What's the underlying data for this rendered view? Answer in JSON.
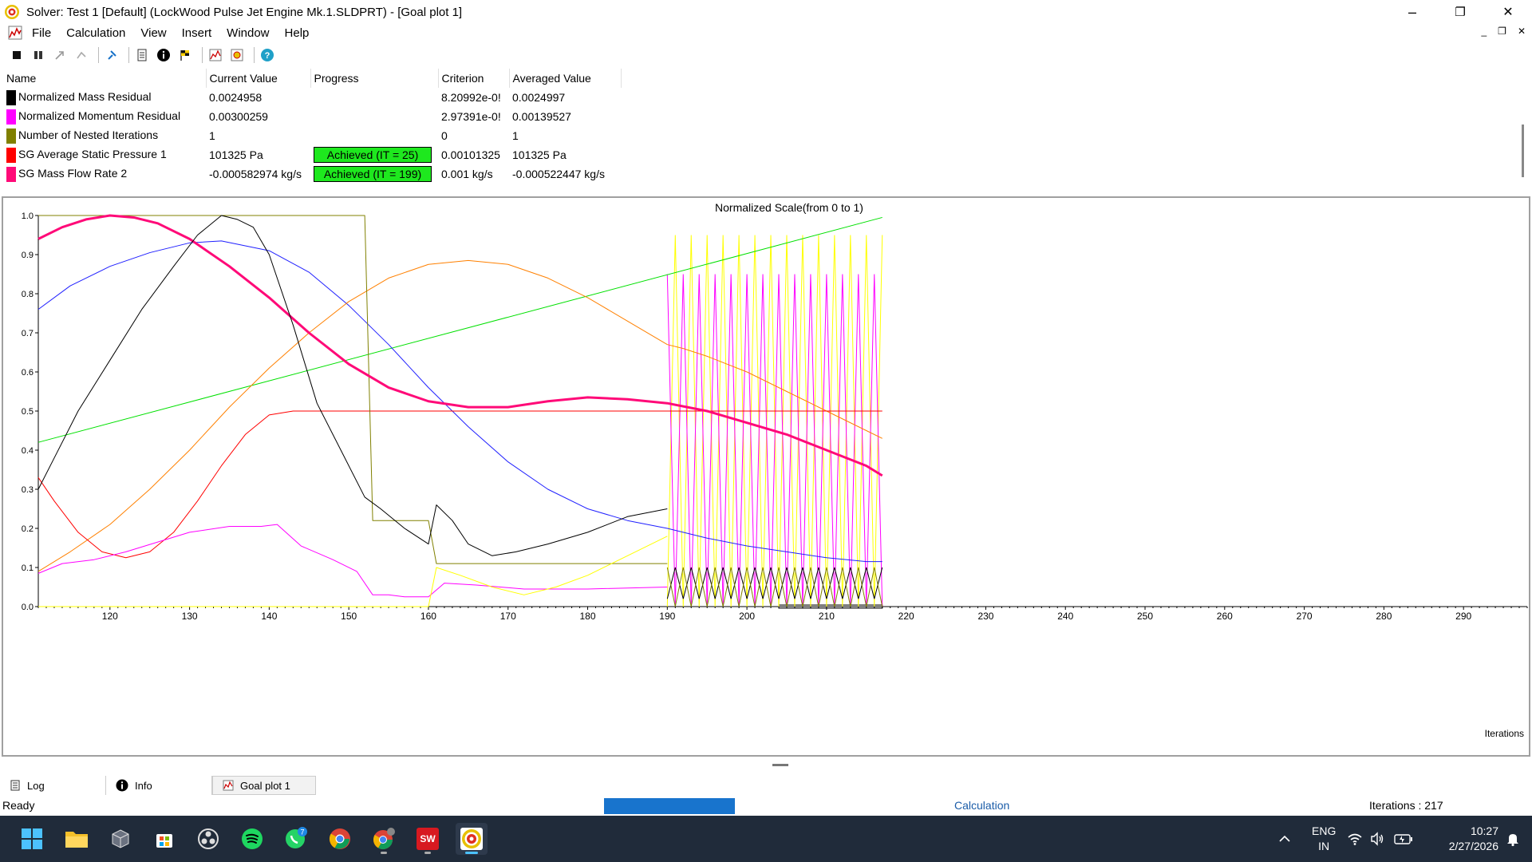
{
  "window": {
    "title": "Solver: Test 1 [Default] (LockWood Pulse Jet Engine Mk.1.SLDPRT) - [Goal plot 1]",
    "minimize": "–",
    "maximize": "❐",
    "close": "✕"
  },
  "menu": {
    "items": [
      "File",
      "Calculation",
      "View",
      "Insert",
      "Window",
      "Help"
    ],
    "mdi_minimize": "_",
    "mdi_restore": "❐",
    "mdi_close": "✕"
  },
  "table": {
    "headers": [
      "Name",
      "Current Value",
      "Progress",
      "Criterion",
      "Averaged Value"
    ],
    "rows": [
      {
        "color": "#000000",
        "name": "Normalized Mass Residual",
        "current": "0.0024958",
        "progress": "",
        "criterion": "8.20992e-0!",
        "averaged": "0.0024997"
      },
      {
        "color": "#ff00ff",
        "name": "Normalized Momentum Residual",
        "current": "0.00300259",
        "progress": "",
        "criterion": "2.97391e-0!",
        "averaged": "0.00139527"
      },
      {
        "color": "#808000",
        "name": "Number of Nested Iterations",
        "current": "1",
        "progress": "",
        "criterion": "0",
        "averaged": "1"
      },
      {
        "color": "#ff0000",
        "name": "SG Average Static Pressure 1",
        "current": "101325 Pa",
        "progress": "Achieved (IT = 25)",
        "criterion": "0.00101325",
        "averaged": "101325 Pa"
      },
      {
        "color": "#ff0a78",
        "name": "SG Mass Flow Rate 2",
        "current": "-0.000582974 kg/s",
        "progress": "Achieved (IT = 199)",
        "criterion": "0.001 kg/s",
        "averaged": "-0.000522447 kg/s"
      }
    ]
  },
  "chart_data": {
    "type": "line",
    "title": "Normalized Scale(from 0 to 1)",
    "xlabel": "Iterations",
    "ylabel": "",
    "xlim": [
      111,
      298
    ],
    "ylim": [
      0,
      1
    ],
    "x_ticks": [
      "120",
      "130",
      "140",
      "150",
      "160",
      "170",
      "180",
      "190",
      "200",
      "210",
      "220",
      "230",
      "240",
      "250",
      "260",
      "270",
      "280",
      "290"
    ],
    "y_ticks": [
      "0.0",
      "0.1",
      "0.2",
      "0.3",
      "0.4",
      "0.5",
      "0.6",
      "0.7",
      "0.8",
      "0.9",
      "1.0"
    ],
    "grid": false,
    "series": [
      {
        "color": "#00e000",
        "width": 1,
        "x": [
          111,
          217
        ],
        "y": [
          0.42,
          0.995
        ]
      },
      {
        "color": "#2020ff",
        "width": 1,
        "x": [
          111,
          115,
          120,
          125,
          130,
          134,
          140,
          145,
          150,
          155,
          160,
          165,
          170,
          175,
          180,
          185,
          190,
          195,
          200,
          205,
          210,
          215,
          217
        ],
        "y": [
          0.76,
          0.82,
          0.87,
          0.905,
          0.93,
          0.935,
          0.91,
          0.855,
          0.77,
          0.67,
          0.56,
          0.46,
          0.37,
          0.3,
          0.25,
          0.22,
          0.2,
          0.175,
          0.155,
          0.14,
          0.125,
          0.115,
          0.115
        ]
      },
      {
        "color": "#ff8000",
        "width": 1,
        "x": [
          111,
          115,
          120,
          125,
          130,
          135,
          140,
          145,
          150,
          155,
          160,
          165,
          170,
          175,
          180,
          185,
          190,
          192,
          195,
          200,
          205,
          210,
          215,
          217
        ],
        "y": [
          0.09,
          0.14,
          0.21,
          0.3,
          0.4,
          0.51,
          0.61,
          0.7,
          0.78,
          0.84,
          0.875,
          0.885,
          0.875,
          0.84,
          0.79,
          0.73,
          0.67,
          0.66,
          0.64,
          0.6,
          0.55,
          0.5,
          0.45,
          0.43
        ]
      },
      {
        "color": "#ff0000",
        "width": 1,
        "x": [
          111,
          113,
          116,
          119,
          122,
          125,
          128,
          131,
          134,
          137,
          140,
          143,
          150,
          160,
          170,
          180,
          190,
          200,
          210,
          217
        ],
        "y": [
          0.33,
          0.27,
          0.19,
          0.14,
          0.125,
          0.14,
          0.19,
          0.27,
          0.36,
          0.44,
          0.49,
          0.5,
          0.5,
          0.5,
          0.5,
          0.5,
          0.5,
          0.5,
          0.5,
          0.5
        ]
      },
      {
        "color": "#808000",
        "width": 1,
        "x": [
          111,
          152,
          153,
          157,
          160,
          161,
          190
        ],
        "y": [
          1.0,
          1.0,
          0.22,
          0.22,
          0.22,
          0.11,
          0.11
        ]
      },
      {
        "color": "#ff0a78",
        "width": 3,
        "x": [
          111,
          114,
          117,
          120,
          123,
          126,
          130,
          135,
          140,
          145,
          150,
          155,
          160,
          165,
          170,
          175,
          180,
          185,
          190,
          195,
          200,
          205,
          210,
          215,
          217
        ],
        "y": [
          0.94,
          0.97,
          0.99,
          1.0,
          0.995,
          0.98,
          0.94,
          0.87,
          0.79,
          0.7,
          0.62,
          0.56,
          0.525,
          0.51,
          0.51,
          0.525,
          0.535,
          0.53,
          0.52,
          0.5,
          0.47,
          0.44,
          0.4,
          0.36,
          0.335
        ]
      },
      {
        "color": "#000000",
        "width": 1,
        "x": [
          111,
          113,
          116,
          120,
          124,
          128,
          131,
          134,
          136,
          138,
          140,
          143,
          146,
          149,
          152,
          154,
          157,
          160,
          161,
          163,
          165,
          168,
          171,
          175,
          180,
          185,
          190
        ],
        "y": [
          0.3,
          0.38,
          0.5,
          0.63,
          0.76,
          0.87,
          0.95,
          1.0,
          0.99,
          0.97,
          0.9,
          0.72,
          0.52,
          0.4,
          0.28,
          0.25,
          0.2,
          0.16,
          0.26,
          0.22,
          0.16,
          0.13,
          0.14,
          0.16,
          0.19,
          0.23,
          0.25
        ]
      },
      {
        "color": "#ff00ff",
        "width": 1,
        "x": [
          111,
          114,
          118,
          122,
          126,
          130,
          135,
          139,
          141,
          144,
          148,
          151,
          153,
          155,
          157,
          160,
          162,
          166,
          172,
          180,
          190
        ],
        "y": [
          0.085,
          0.11,
          0.12,
          0.14,
          0.165,
          0.19,
          0.205,
          0.205,
          0.21,
          0.155,
          0.12,
          0.09,
          0.03,
          0.03,
          0.025,
          0.025,
          0.06,
          0.055,
          0.045,
          0.045,
          0.05
        ]
      },
      {
        "color": "#ffff00",
        "width": 1,
        "x": [
          111,
          160,
          161,
          164,
          168,
          172,
          176,
          180,
          185,
          190
        ],
        "y": [
          0.0,
          0.0,
          0.1,
          0.08,
          0.05,
          0.03,
          0.05,
          0.08,
          0.13,
          0.18
        ]
      }
    ],
    "oscillations": {
      "x_start": 190,
      "x_end": 217,
      "period": 2,
      "series": [
        {
          "color": "#ffff00",
          "low": 0.0,
          "high": 0.95
        },
        {
          "color": "#ff00ff",
          "low": 0.0,
          "high": 0.85
        },
        {
          "color": "#000000",
          "low": 0.02,
          "high": 0.1
        },
        {
          "color": "#808000",
          "low": 0.0,
          "high": 0.1
        }
      ]
    }
  },
  "tabs": [
    {
      "label": "Log",
      "icon": "log-icon"
    },
    {
      "label": "Info",
      "icon": "info-icon"
    },
    {
      "label": "Goal plot 1",
      "icon": "goal-plot-icon"
    }
  ],
  "status": {
    "ready": "Ready",
    "calculation": "Calculation",
    "iterations": "Iterations : 217",
    "progress_fraction": 0.31
  },
  "taskbar": {
    "whatsapp_badge": "7",
    "lang_line1": "ENG",
    "lang_line2": "IN",
    "time": "10:27",
    "date": "2/27/2026"
  }
}
